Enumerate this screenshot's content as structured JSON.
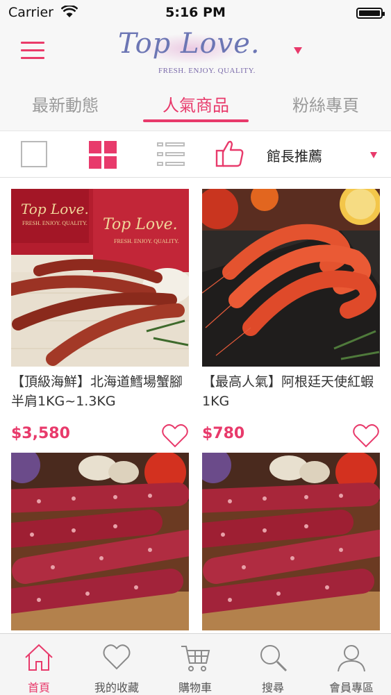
{
  "status_bar": {
    "carrier": "Carrier",
    "time": "5:16 PM"
  },
  "logo": {
    "wordmark": "Top Love.",
    "tagline": "FRESH. ENJOY. QUALITY."
  },
  "tabs": [
    {
      "label": "最新動態",
      "active": false
    },
    {
      "label": "人氣商品",
      "active": true
    },
    {
      "label": "粉絲專頁",
      "active": false
    }
  ],
  "toolbar": {
    "sort_label": "館長推薦",
    "active_view": "grid"
  },
  "products": [
    {
      "title": "【頂級海鮮】北海道鱈場蟹腳 半肩1KG~1.3KG",
      "price": "$3,580",
      "image": "crab-legs"
    },
    {
      "title": "【最高人氣】阿根廷天使紅蝦1KG",
      "price": "$780",
      "image": "red-shrimp"
    },
    {
      "title": "",
      "price": "",
      "image": "king-crab"
    },
    {
      "title": "",
      "price": "",
      "image": "king-crab"
    }
  ],
  "tab_bar": [
    {
      "label": "首頁",
      "icon": "home-icon",
      "active": true
    },
    {
      "label": "我的收藏",
      "icon": "heart-icon",
      "active": false
    },
    {
      "label": "購物車",
      "icon": "cart-icon",
      "active": false
    },
    {
      "label": "搜尋",
      "icon": "search-icon",
      "active": false
    },
    {
      "label": "會員專區",
      "icon": "user-icon",
      "active": false
    }
  ],
  "colors": {
    "accent": "#e83a6b",
    "inactive_text": "#9a9a9a",
    "bar_bg": "#f7f7f7"
  }
}
